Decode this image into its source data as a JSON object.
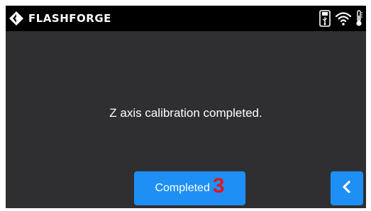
{
  "header": {
    "brand": "FLASHFORGE",
    "logo_icon": "flashforge-logo-icon",
    "status_icons": [
      "usb-icon",
      "wifi-icon",
      "thermometer-icon"
    ]
  },
  "main": {
    "message": "Z axis calibration completed."
  },
  "buttons": {
    "completed_label": "Completed",
    "completed_badge": "3",
    "back_icon": "chevron-left-icon"
  },
  "colors": {
    "screen_bg": "#2f2f31",
    "topbar_bg": "#000000",
    "accent": "#1e8ff5",
    "badge": "#e0161e",
    "text": "#ffffff"
  }
}
